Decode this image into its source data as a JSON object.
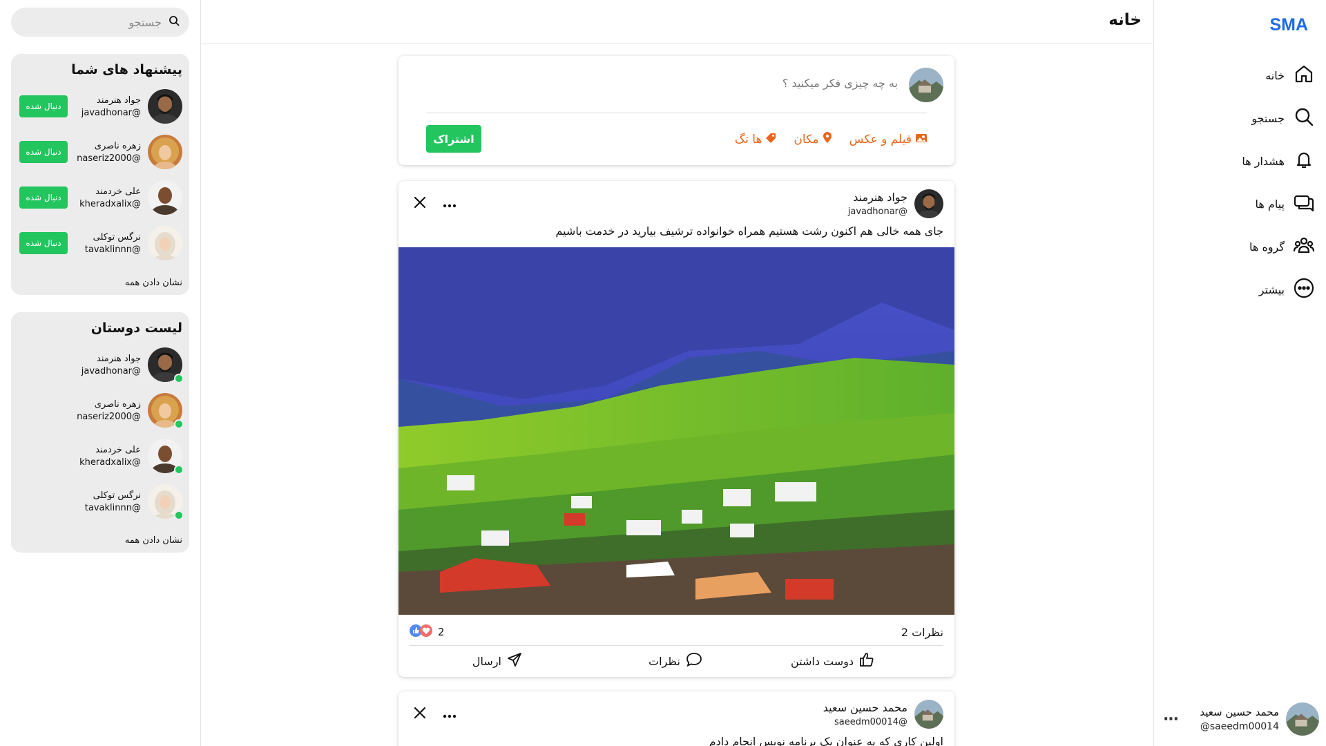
{
  "app": {
    "logo": "SMA"
  },
  "nav": {
    "items": [
      {
        "label": "خانه",
        "icon": "home-icon"
      },
      {
        "label": "جستجو",
        "icon": "search-icon"
      },
      {
        "label": "هشدار ها",
        "icon": "bell-icon"
      },
      {
        "label": "پیام ها",
        "icon": "chat-icon"
      },
      {
        "label": "گروه ها",
        "icon": "group-icon"
      },
      {
        "label": "بیشتر",
        "icon": "more-circle-icon"
      }
    ]
  },
  "current_user": {
    "name": "محمد حسین سعید",
    "handle": "saeedm00014@"
  },
  "header": {
    "title": "خانه"
  },
  "composer": {
    "placeholder": "به چه چیزی فکر میکنید ؟",
    "actions": [
      {
        "label": "فیلم و عکس",
        "icon": "photo-icon"
      },
      {
        "label": "مکان",
        "icon": "location-pin-icon"
      },
      {
        "label": "ها تگ",
        "icon": "tag-icon"
      }
    ],
    "share_label": "اشتراک"
  },
  "posts": [
    {
      "author": "جواد هنرمند",
      "handle": "javadhonar@",
      "text": "جای همه خالی هم اکنون رشت هستیم همراه خوانواده ترشیف بیارید در خدمت باشیم",
      "comments_label": "نظرات 2",
      "reactions_count": "2",
      "actions": {
        "like": "دوست داشتن",
        "comment": "نظرات",
        "send": "ارسال"
      }
    },
    {
      "author": "محمد حسین سعید",
      "handle": "saeedm00014@",
      "text": "اولین کاری که به عنوان یک برنامه نویس انجام دادم"
    }
  ],
  "search": {
    "placeholder": "جستجو"
  },
  "suggestions": {
    "title": "پیشنهاد های شما",
    "follow_label": "دنبال شده",
    "show_all": "نشان دادن همه",
    "people": [
      {
        "name": "جواد هنرمند",
        "handle": "javadhonar@"
      },
      {
        "name": "زهره ناصری",
        "handle": "naseriz2000@"
      },
      {
        "name": "علی خردمند",
        "handle": "kheradxalix@"
      },
      {
        "name": "نرگس توکلی",
        "handle": "tavaklinnn@"
      }
    ]
  },
  "friends": {
    "title": "لیست دوستان",
    "show_all": "نشان دادن همه",
    "people": [
      {
        "name": "جواد هنرمند",
        "handle": "javadhonar@"
      },
      {
        "name": "زهره ناصری",
        "handle": "naseriz2000@"
      },
      {
        "name": "علی خردمند",
        "handle": "kheradxalix@"
      },
      {
        "name": "نرگس توکلی",
        "handle": "tavaklinnn@"
      }
    ]
  },
  "colors": {
    "brand": "#1d6be8",
    "accent": "#22c55e",
    "action_orange": "#e8661b"
  }
}
